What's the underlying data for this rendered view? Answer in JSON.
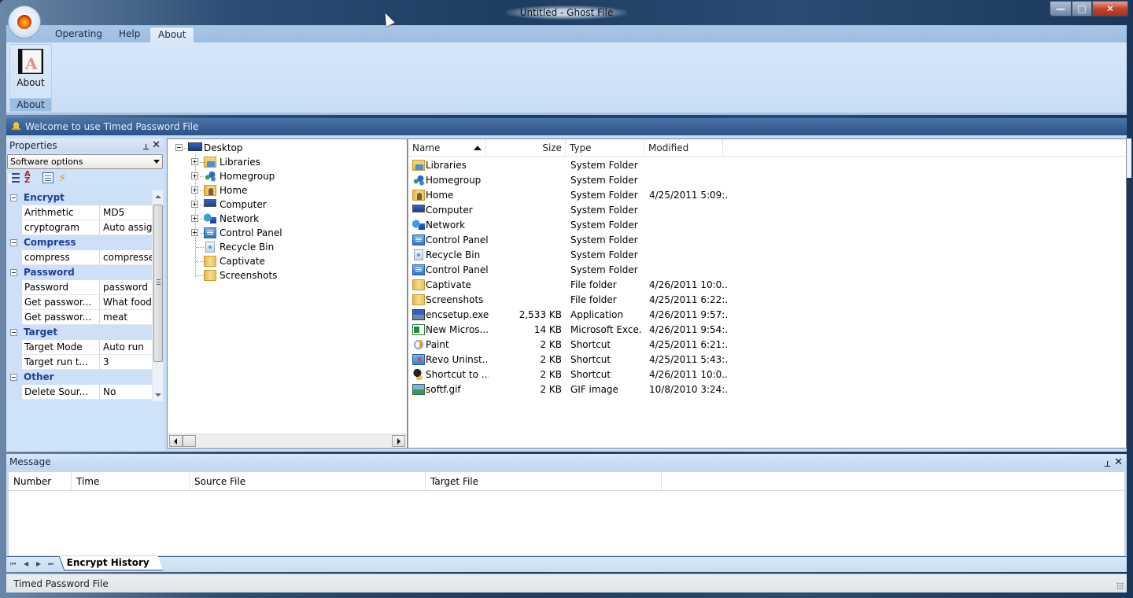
{
  "window": {
    "title": "Untitled - Ghost File",
    "controls": {
      "minimize": "—",
      "maximize": "□",
      "close": "✕"
    }
  },
  "ribbon": {
    "tabs": [
      {
        "label": "Operating",
        "active": false
      },
      {
        "label": "Help",
        "active": false
      },
      {
        "label": "About",
        "active": true
      }
    ],
    "groups": [
      {
        "label": "About",
        "buttons": [
          {
            "label": "About",
            "icon": "about-document-icon"
          }
        ]
      }
    ]
  },
  "welcome_bar": {
    "text": "Welcome to use Timed Password File",
    "icon": "bell-icon"
  },
  "properties": {
    "title": "Properties",
    "combo_value": "Software options",
    "toolbar": [
      {
        "name": "categorized-icon"
      },
      {
        "name": "sort-alphabetical-icon",
        "glyph": "A Z"
      },
      {
        "name": "property-pages-icon"
      },
      {
        "name": "events-lightning-icon",
        "glyph": "⚡"
      }
    ],
    "categories": [
      {
        "name": "Encrypt",
        "rows": [
          {
            "name": "Arithmetic",
            "value": "MD5"
          },
          {
            "name": "cryptogram",
            "value": "Auto assign"
          }
        ]
      },
      {
        "name": "Compress",
        "rows": [
          {
            "name": "compress",
            "value": "compressed"
          }
        ]
      },
      {
        "name": "Password",
        "rows": [
          {
            "name": "Password",
            "value": "password"
          },
          {
            "name": "Get passwor...",
            "value": "What food y..."
          },
          {
            "name": "Get passwor...",
            "value": "meat"
          }
        ]
      },
      {
        "name": "Target",
        "rows": [
          {
            "name": "Target Mode",
            "value": "Auto run"
          },
          {
            "name": "Target run t...",
            "value": "3"
          }
        ]
      },
      {
        "name": "Other",
        "rows": [
          {
            "name": "Delete Sour...",
            "value": "No"
          }
        ]
      }
    ]
  },
  "tree": {
    "root": {
      "label": "Desktop",
      "icon": "desktop-icon",
      "expanded": true
    },
    "children": [
      {
        "label": "Libraries",
        "icon": "libraries-icon",
        "expandable": true
      },
      {
        "label": "Homegroup",
        "icon": "homegroup-icon",
        "expandable": true
      },
      {
        "label": "Home",
        "icon": "home-folder-icon",
        "expandable": true
      },
      {
        "label": "Computer",
        "icon": "computer-icon",
        "expandable": true
      },
      {
        "label": "Network",
        "icon": "network-icon",
        "expandable": true
      },
      {
        "label": "Control Panel",
        "icon": "control-panel-icon",
        "expandable": true
      },
      {
        "label": "Recycle Bin",
        "icon": "recycle-bin-icon",
        "expandable": false
      },
      {
        "label": "Captivate",
        "icon": "folder-icon",
        "expandable": false
      },
      {
        "label": "Screenshots",
        "icon": "folder-icon",
        "expandable": false
      }
    ]
  },
  "file_list": {
    "columns": [
      {
        "label": "Name",
        "sorted": "ascending"
      },
      {
        "label": "Size"
      },
      {
        "label": "Type"
      },
      {
        "label": "Modified"
      }
    ],
    "rows": [
      {
        "name": "Libraries",
        "size": "",
        "type": "System Folder",
        "modified": "",
        "icon": "libraries-icon"
      },
      {
        "name": "Homegroup",
        "size": "",
        "type": "System Folder",
        "modified": "",
        "icon": "homegroup-icon"
      },
      {
        "name": "Home",
        "size": "",
        "type": "System Folder",
        "modified": "4/25/2011 5:09:...",
        "icon": "home-folder-icon"
      },
      {
        "name": "Computer",
        "size": "",
        "type": "System Folder",
        "modified": "",
        "icon": "computer-icon"
      },
      {
        "name": "Network",
        "size": "",
        "type": "System Folder",
        "modified": "",
        "icon": "network-icon"
      },
      {
        "name": "Control Panel",
        "size": "",
        "type": "System Folder",
        "modified": "",
        "icon": "control-panel-icon"
      },
      {
        "name": "Recycle Bin",
        "size": "",
        "type": "System Folder",
        "modified": "",
        "icon": "recycle-bin-icon"
      },
      {
        "name": "Control Panel",
        "size": "",
        "type": "System Folder",
        "modified": "",
        "icon": "control-panel-icon"
      },
      {
        "name": "Captivate",
        "size": "",
        "type": "File folder",
        "modified": "4/26/2011 10:0...",
        "icon": "folder-icon"
      },
      {
        "name": "Screenshots",
        "size": "",
        "type": "File folder",
        "modified": "4/25/2011 6:22:...",
        "icon": "folder-icon"
      },
      {
        "name": "encsetup.exe",
        "size": "2,533 KB",
        "type": "Application",
        "modified": "4/26/2011 9:57:...",
        "icon": "application-icon"
      },
      {
        "name": "New Micros...",
        "size": "14 KB",
        "type": "Microsoft Exce...",
        "modified": "4/26/2011 9:54:...",
        "icon": "excel-file-icon"
      },
      {
        "name": "Paint",
        "size": "2 KB",
        "type": "Shortcut",
        "modified": "4/25/2011 6:21:...",
        "icon": "paint-icon"
      },
      {
        "name": "Revo Uninst...",
        "size": "2 KB",
        "type": "Shortcut",
        "modified": "4/25/2011 5:43:...",
        "icon": "revo-uninstaller-icon"
      },
      {
        "name": "Shortcut to ...",
        "size": "2 KB",
        "type": "Shortcut",
        "modified": "4/26/2011 10:0...",
        "icon": "shortcut-icon"
      },
      {
        "name": "softf.gif",
        "size": "2 KB",
        "type": "GIF image",
        "modified": "10/8/2010 3:24:...",
        "icon": "gif-image-icon"
      }
    ]
  },
  "message_panel": {
    "title": "Message",
    "columns": [
      "Number",
      "Time",
      "Source File",
      "Target File"
    ],
    "rows": [],
    "tabs": [
      {
        "label": "Encrypt History",
        "active": true
      }
    ],
    "nav": {
      "first": "⏮",
      "prev": "◀",
      "next": "▶",
      "last": "⏭"
    }
  },
  "status_bar": {
    "text": "Timed Password File"
  }
}
